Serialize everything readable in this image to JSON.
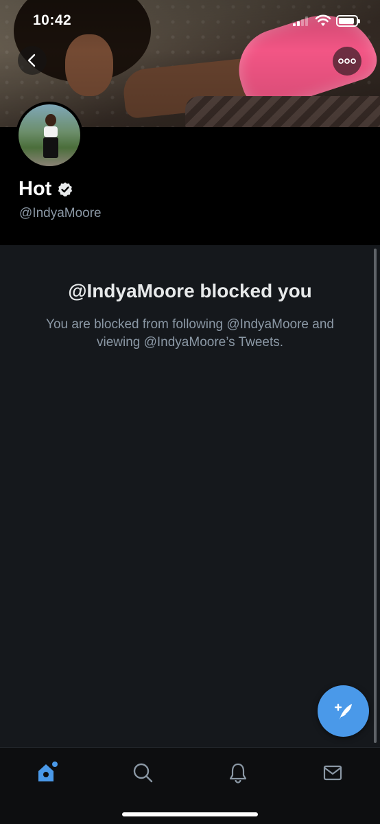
{
  "status_bar": {
    "time": "10:42"
  },
  "profile": {
    "display_name": "Hot",
    "handle": "@IndyaMoore",
    "verified": true
  },
  "blocked": {
    "title": "@IndyaMoore blocked you",
    "message": "You are blocked from following @IndyaMoore and viewing @IndyaMoore’s Tweets."
  },
  "icons": {
    "back": "chevron-left-icon",
    "more": "more-horizontal-icon",
    "compose": "compose-tweet-icon",
    "home": "home-icon",
    "search": "search-icon",
    "notifications": "bell-icon",
    "messages": "mail-icon"
  },
  "colors": {
    "accent": "#4a99e9",
    "background": "#15181c",
    "secondary_text": "#8b98a5"
  }
}
